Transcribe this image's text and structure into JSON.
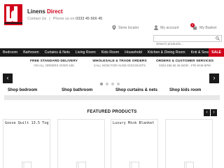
{
  "header": {
    "brand_part1": "Linens",
    "brand_part2": "Direct",
    "contact_label": "Contact Us",
    "phone_label": "Phone us on",
    "phone_number": "0333 45 666 45",
    "store_locator": "Store locator",
    "my_account": "My account",
    "my_basket": "My Basket",
    "basket_count": "0",
    "search_placeholder": "Search products..."
  },
  "nav": {
    "items": [
      {
        "label": "Bedroom"
      },
      {
        "label": "Bathroom"
      },
      {
        "label": "Curtains & Nets"
      },
      {
        "label": "Living Room"
      },
      {
        "label": "Kids Room"
      },
      {
        "label": "Household"
      },
      {
        "label": "Kitchen & Dining Room"
      },
      {
        "label": "Knit & Sew"
      }
    ],
    "sale_label": "SALE"
  },
  "promos": [
    {
      "title": "FREE STANDARD DELIVERY",
      "subtitle": "ON ALL ORDERS OVER £35"
    },
    {
      "title": "WHOLESALE & TRADE ORDERS",
      "subtitle": "CALL NOW FOR HUGE DISCOUNTS"
    },
    {
      "title": "ORDERS & CUSTOMER SERVICES",
      "subtitle": "0333 456 66 45 MON - FRI 8AM-5PM"
    }
  ],
  "slider": {
    "categories": [
      {
        "label": "Shop bedroom"
      },
      {
        "label": "Shop bathroom"
      },
      {
        "label": "Shop curtains & nets"
      },
      {
        "label": "Shop kids room"
      }
    ],
    "dot_count": 4,
    "active_dot": 0
  },
  "featured": {
    "title": "FEATURED PRODUCTS",
    "products": [
      {
        "name": "Goose Quilt 13.5 Tog"
      },
      {
        "name": ""
      },
      {
        "name": "Luxury Mink Blanket"
      },
      {
        "name": ""
      }
    ]
  },
  "colors": {
    "brand_red": "#d0021b",
    "nav_bg": "#1a1a1a"
  }
}
